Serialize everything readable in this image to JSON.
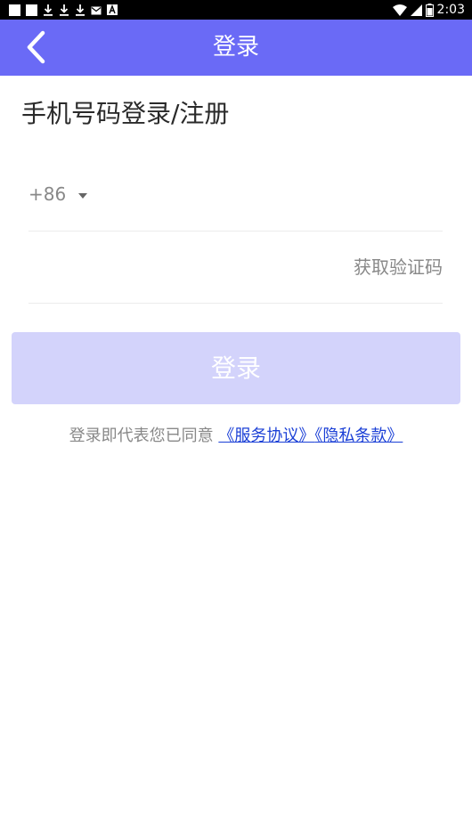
{
  "status_bar": {
    "time": "2:03",
    "icons": [
      "notification-square-icon",
      "notification-square-icon",
      "download-icon",
      "download-icon",
      "download-icon",
      "mail-icon",
      "app-a-icon",
      "wifi-icon",
      "signal-icon",
      "battery-icon"
    ]
  },
  "app_bar": {
    "title": "登录",
    "back_icon": "chevron-left-icon",
    "color": "#6a6af6"
  },
  "form": {
    "heading": "手机号码登录/注册",
    "country_code": "+86",
    "country_dropdown_icon": "caret-down-icon",
    "phone_value": "",
    "code_value": "",
    "get_code_label": "获取验证码"
  },
  "login_button": {
    "label": "登录",
    "color": "#d3d3fb"
  },
  "agreement": {
    "prefix": "登录即代表您已同意",
    "service_link": "《服务协议》",
    "privacy_link": "《隐私条款》",
    "link_color": "#1a3fd6"
  }
}
